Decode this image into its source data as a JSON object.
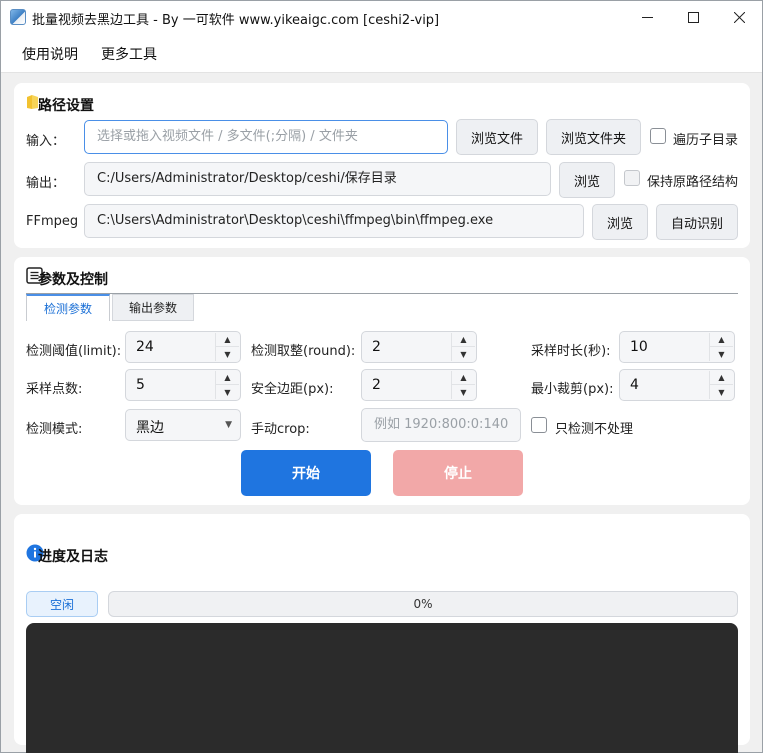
{
  "window": {
    "title": "批量视频去黑边工具 - By 一可软件 www.yikeaigc.com  [ceshi2-vip]"
  },
  "menu": {
    "items": [
      "使用说明",
      "更多工具"
    ]
  },
  "path_settings": {
    "title": "路径设置",
    "input": {
      "label": "输入：",
      "value": "",
      "placeholder": "选择或拖入视频文件 / 多文件(;分隔) / 文件夹",
      "browse_file": "浏览文件",
      "browse_folder": "浏览文件夹",
      "recurse_label": "遍历子目录",
      "recurse_checked": false
    },
    "output": {
      "label": "输出：",
      "value": "C:/Users/Administrator/Desktop/ceshi/保存目录",
      "browse": "浏览",
      "keep_structure_label": "保持原路径结构",
      "keep_structure_checked": false
    },
    "ffmpeg": {
      "label": "FFmpeg",
      "value": "C:\\Users\\Administrator\\Desktop\\ceshi\\ffmpeg\\bin\\ffmpeg.exe",
      "browse": "浏览",
      "auto_detect": "自动识别"
    }
  },
  "params": {
    "title": "参数及控制",
    "tabs": [
      {
        "label": "检测参数",
        "active": true
      },
      {
        "label": "输出参数",
        "active": false
      }
    ],
    "fields": {
      "limit": {
        "label": "检测阈值(limit):",
        "value": "24"
      },
      "round": {
        "label": "检测取整(round):",
        "value": "2"
      },
      "duration": {
        "label": "采样时长(秒):",
        "value": "10"
      },
      "points": {
        "label": "采样点数:",
        "value": "5"
      },
      "margin": {
        "label": "安全边距(px):",
        "value": "2"
      },
      "min_crop": {
        "label": "最小裁剪(px):",
        "value": "4"
      },
      "mode": {
        "label": "检测模式:",
        "value": "黑边"
      },
      "manual_crop": {
        "label": "手动crop:",
        "placeholder": "例如 1920:800:0:140"
      },
      "detect_only": {
        "label": "只检测不处理",
        "checked": false
      }
    },
    "start_button": "开始",
    "stop_button": "停止"
  },
  "log": {
    "title": "进度及日志",
    "status": "空闲",
    "progress": 0,
    "progress_text": "0%"
  },
  "colors": {
    "accent": "#1f75e0",
    "stop": "#f2a8a8",
    "log_bg": "#2b2b2b"
  }
}
